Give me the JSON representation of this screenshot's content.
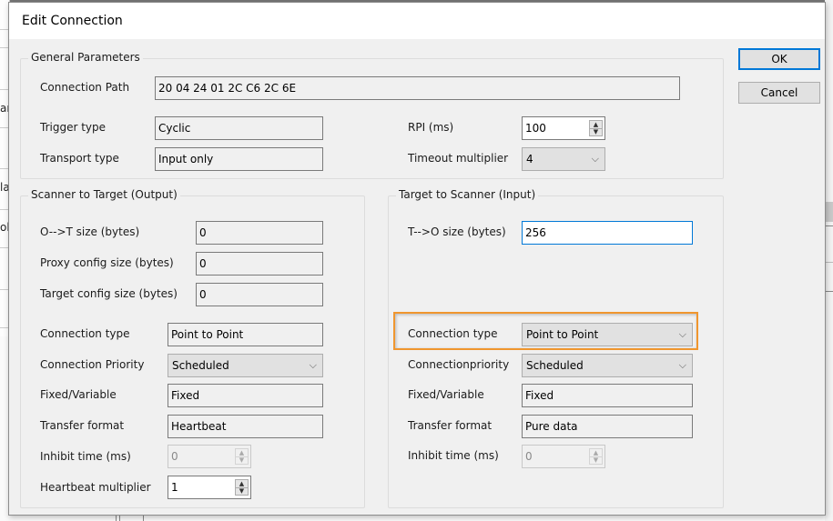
{
  "background": {
    "left_fragments": [
      "ar",
      "la",
      "ob"
    ]
  },
  "dialog": {
    "title": "Edit Connection",
    "buttons": {
      "ok": "OK",
      "cancel": "Cancel"
    },
    "general": {
      "group_label": "General Parameters",
      "connection_path": {
        "label": "Connection Path",
        "value": "20 04 24 01 2C C6 2C 6E"
      },
      "trigger_type": {
        "label": "Trigger type",
        "value": "Cyclic"
      },
      "transport_type": {
        "label": "Transport type",
        "value": "Input only"
      },
      "rpi": {
        "label": "RPI (ms)",
        "value": "100"
      },
      "timeout_multiplier": {
        "label": "Timeout multiplier",
        "value": "4"
      }
    },
    "output": {
      "group_label": "Scanner to Target (Output)",
      "ot_size": {
        "label": "O-->T size (bytes)",
        "value": "0"
      },
      "proxy_config_size": {
        "label": "Proxy config size (bytes)",
        "value": "0"
      },
      "target_config_size": {
        "label": "Target config size (bytes)",
        "value": "0"
      },
      "connection_type": {
        "label": "Connection type",
        "value": "Point to Point"
      },
      "connection_priority": {
        "label": "Connection Priority",
        "value": "Scheduled"
      },
      "fixed_variable": {
        "label": "Fixed/Variable",
        "value": "Fixed"
      },
      "transfer_format": {
        "label": "Transfer format",
        "value": "Heartbeat"
      },
      "inhibit_time": {
        "label": "Inhibit time (ms)",
        "value": "0"
      },
      "heartbeat_multiplier": {
        "label": "Heartbeat multiplier",
        "value": "1"
      }
    },
    "input": {
      "group_label": "Target to Scanner (Input)",
      "to_size": {
        "label": "T-->O size (bytes)",
        "value": "256"
      },
      "connection_type": {
        "label": "Connection type",
        "value": "Point to Point"
      },
      "connection_priority": {
        "label": "Connectionpriority",
        "value": "Scheduled"
      },
      "fixed_variable": {
        "label": "Fixed/Variable",
        "value": "Fixed"
      },
      "transfer_format": {
        "label": "Transfer format",
        "value": "Pure data"
      },
      "inhibit_time": {
        "label": "Inhibit time (ms)",
        "value": "0"
      }
    },
    "highlight_color": "#f0962e",
    "focus_color": "#0078d7"
  },
  "icons": {
    "chevron": "⌵",
    "spin_up": "▲",
    "spin_down": "▼"
  }
}
